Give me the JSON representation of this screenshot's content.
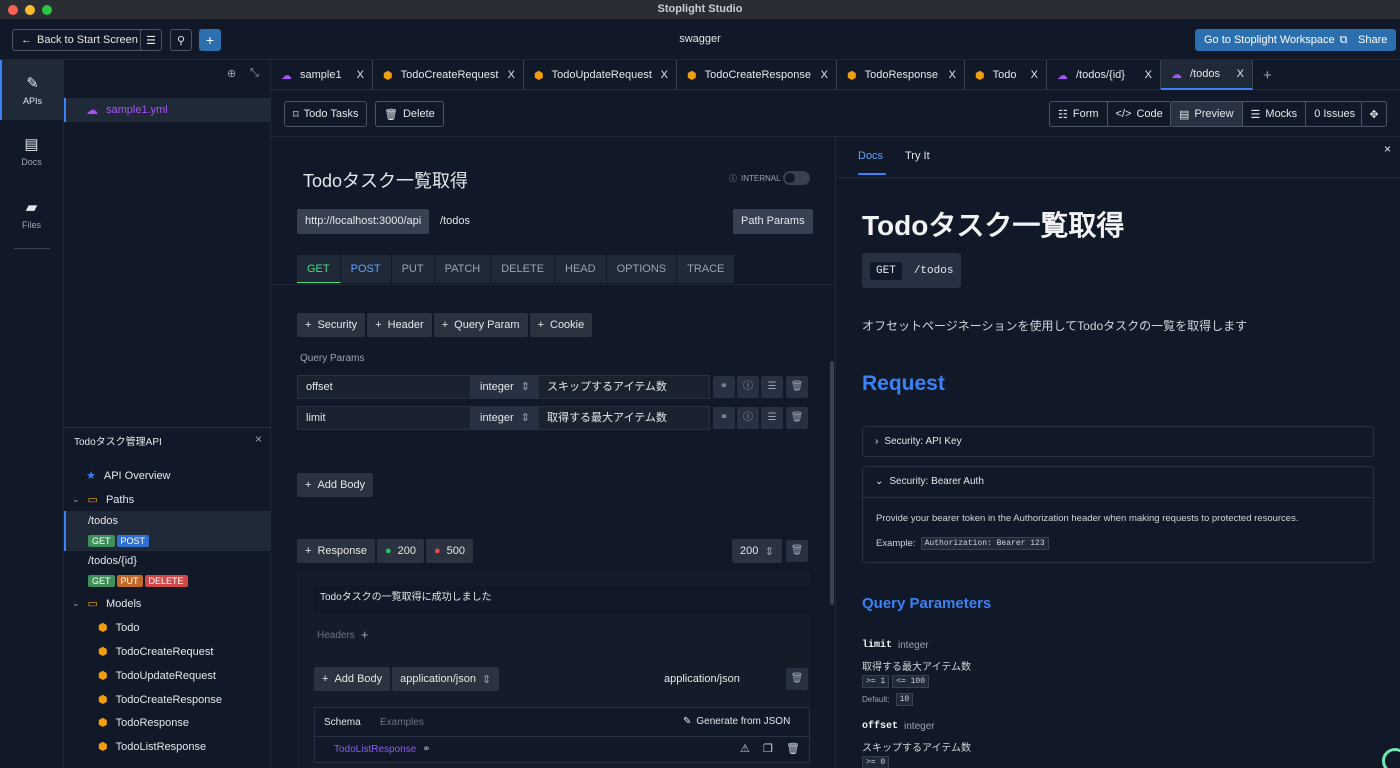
{
  "window_title": "Stoplight Studio",
  "topbar": {
    "back_label": "Back to Start Screen",
    "center_title": "swagger",
    "workspace_label": "Go to Stoplight Workspace",
    "share_label": "Share"
  },
  "rail": [
    {
      "label": "APIs",
      "icon": "compass-icon"
    },
    {
      "label": "Docs",
      "icon": "document-icon"
    },
    {
      "label": "Files",
      "icon": "folder-icon"
    }
  ],
  "sidebar": {
    "file_name": "sample1.yml",
    "api_title": "Todoタスク管理API",
    "overview_label": "API Overview",
    "paths_label": "Paths",
    "paths": [
      {
        "path": "/todos",
        "methods": [
          "GET",
          "POST"
        ]
      },
      {
        "path": "/todos/{id}",
        "methods": [
          "GET",
          "PUT",
          "DELETE"
        ]
      }
    ],
    "models_label": "Models",
    "models": [
      "Todo",
      "TodoCreateRequest",
      "TodoUpdateRequest",
      "TodoCreateResponse",
      "TodoResponse",
      "TodoListResponse"
    ]
  },
  "tabs": [
    {
      "label": "sample1",
      "icon": "cloud-icon"
    },
    {
      "label": "TodoCreateRequest",
      "icon": "cube-icon"
    },
    {
      "label": "TodoUpdateRequest",
      "icon": "cube-icon"
    },
    {
      "label": "TodoCreateResponse",
      "icon": "cube-icon"
    },
    {
      "label": "TodoResponse",
      "icon": "cube-icon"
    },
    {
      "label": "Todo",
      "icon": "cube-icon"
    },
    {
      "label": "/todos/{id}",
      "icon": "cloud-icon"
    },
    {
      "label": "/todos",
      "icon": "cloud-icon",
      "active": true
    }
  ],
  "toolbar": {
    "tags_label": "Todo Tasks",
    "delete_label": "Delete",
    "form_label": "Form",
    "code_label": "Code",
    "preview_label": "Preview",
    "mocks_label": "Mocks",
    "issues_label": "0 Issues"
  },
  "editor": {
    "title": "Todoタスク一覧取得",
    "internal_label": "INTERNAL",
    "server": "http://localhost:3000/api",
    "path": "/todos",
    "path_params_label": "Path Params",
    "methods": [
      "GET",
      "POST",
      "PUT",
      "PATCH",
      "DELETE",
      "HEAD",
      "OPTIONS",
      "TRACE"
    ],
    "add_buttons": [
      "Security",
      "Header",
      "Query Param",
      "Cookie"
    ],
    "query_params_label": "Query Params",
    "params": [
      {
        "name": "offset",
        "type": "integer",
        "description": "スキップするアイテム数"
      },
      {
        "name": "limit",
        "type": "integer",
        "description": "取得する最大アイテム数"
      }
    ],
    "add_body_label": "Add Body",
    "response_label": "Response",
    "status_200": "200",
    "status_500": "500",
    "selected_status": "200",
    "response_description": "Todoタスクの一覧取得に成功しました",
    "headers_label": "Headers",
    "body_add_label": "Add Body",
    "content_type": "application/json",
    "content_type_text": "application/json",
    "schema_tab": "Schema",
    "examples_tab": "Examples",
    "generate_label": "Generate from JSON",
    "schema_ref": "TodoListResponse"
  },
  "docs": {
    "tab_docs": "Docs",
    "tab_tryit": "Try It",
    "title": "Todoタスク一覧取得",
    "method": "GET",
    "path": "/todos",
    "description": "オフセットページネーションを使用してTodoタスクの一覧を取得します",
    "request_heading": "Request",
    "security_api_key": "Security: API Key",
    "security_bearer": "Security: Bearer Auth",
    "bearer_desc": "Provide your bearer token in the Authorization header when making requests to protected resources.",
    "example_label": "Example:",
    "example_value": "Authorization: Bearer 123",
    "query_heading": "Query Parameters",
    "params": [
      {
        "name": "limit",
        "type": "integer",
        "description": "取得する最大アイテム数",
        "min": ">= 1",
        "max": "<= 100",
        "default_label": "Default:",
        "default": "10"
      },
      {
        "name": "offset",
        "type": "integer",
        "description": "スキップするアイテム数",
        "min": ">= 0"
      }
    ]
  },
  "colors": {
    "accent": "#3b82f6",
    "get": "#3f8f5a",
    "post": "#2f6fd1",
    "put": "#c2692a",
    "delete": "#d04848"
  }
}
